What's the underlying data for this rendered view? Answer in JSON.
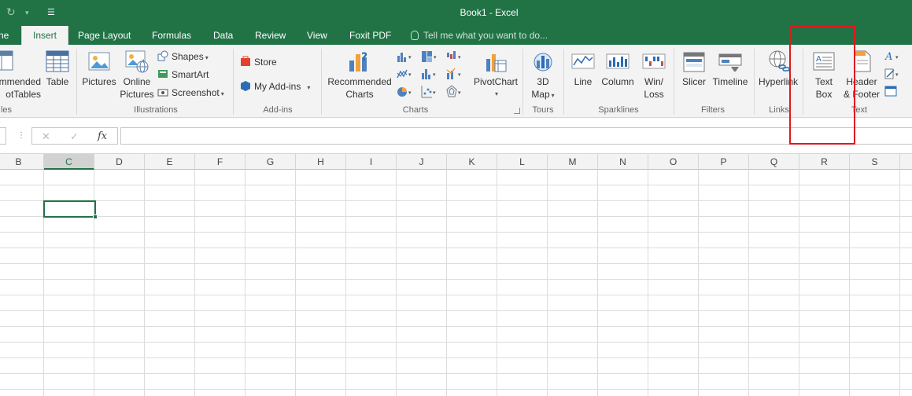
{
  "window": {
    "title": "Book1 - Excel"
  },
  "quick_access": {
    "redo_icon": "redo-icon",
    "customize_icon": "customize-icon"
  },
  "tabs": [
    {
      "label": "ne"
    },
    {
      "label": "Insert",
      "active": true
    },
    {
      "label": "Page Layout"
    },
    {
      "label": "Formulas"
    },
    {
      "label": "Data"
    },
    {
      "label": "Review"
    },
    {
      "label": "View"
    },
    {
      "label": "Foxit PDF"
    }
  ],
  "tell_me": {
    "placeholder": "Tell me what you want to do..."
  },
  "ribbon": {
    "tables": {
      "label": "les",
      "recommended_pivot": {
        "line1": "mmended",
        "line2": "otTables"
      },
      "table": "Table"
    },
    "illustrations": {
      "label": "Illustrations",
      "pictures": "Pictures",
      "online_pictures": {
        "line1": "Online",
        "line2": "Pictures"
      },
      "shapes": "Shapes",
      "smartart": "SmartArt",
      "screenshot": "Screenshot"
    },
    "addins": {
      "label": "Add-ins",
      "store": "Store",
      "my_addins": "My Add-ins"
    },
    "charts": {
      "label": "Charts",
      "recommended_charts": {
        "line1": "Recommended",
        "line2": "Charts"
      },
      "pivotchart": "PivotChart"
    },
    "tours": {
      "label": "Tours",
      "map3d": {
        "line1": "3D",
        "line2": "Map"
      }
    },
    "sparklines": {
      "label": "Sparklines",
      "line": "Line",
      "column": "Column",
      "winloss": {
        "line1": "Win/",
        "line2": "Loss"
      }
    },
    "filters": {
      "label": "Filters",
      "slicer": "Slicer",
      "timeline": "Timeline"
    },
    "links": {
      "label": "Links",
      "hyperlink": "Hyperlink"
    },
    "text": {
      "label": "Text",
      "text_box": {
        "line1": "Text",
        "line2": "Box"
      },
      "header_footer": {
        "line1": "Header",
        "line2": "& Footer"
      }
    }
  },
  "formula_bar": {
    "cancel": "✕",
    "enter": "✓",
    "fx": "fx",
    "value": ""
  },
  "columns": [
    "B",
    "C",
    "D",
    "E",
    "F",
    "G",
    "H",
    "I",
    "J",
    "K",
    "L",
    "M",
    "N",
    "O",
    "P",
    "Q",
    "R",
    "S"
  ],
  "selected_column": "C",
  "colors": {
    "accent": "#217346",
    "highlight": "#e0191b"
  }
}
